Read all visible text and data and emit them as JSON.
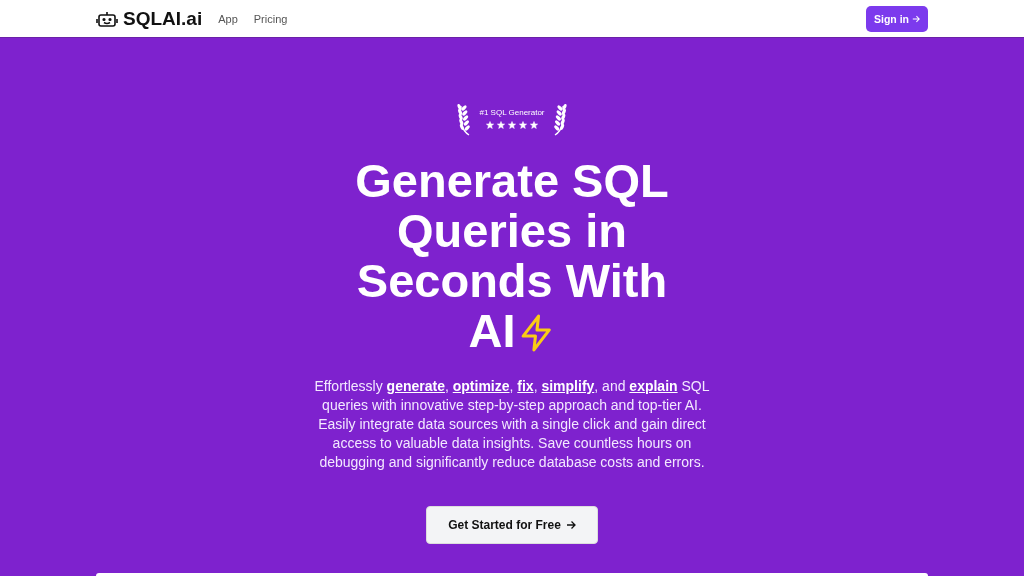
{
  "nav": {
    "logo": "SQLAI.ai",
    "links": [
      {
        "label": "App"
      },
      {
        "label": "Pricing"
      }
    ],
    "sign_in": "Sign in"
  },
  "hero": {
    "award": {
      "label": "#1 SQL Generator",
      "stars": 5
    },
    "headline": "Generate SQL Queries in Seconds With AI",
    "description": "Effortlessly **generate**, **optimize**, **fix**, **simplify**, and **explain** SQL queries with innovative step-by-step approach and top-tier AI. Easily integrate data sources with a single click and gain direct access to valuable data insights. Save countless hours on debugging and significantly reduce database costs and errors.",
    "cta": "Get Started for Free"
  }
}
